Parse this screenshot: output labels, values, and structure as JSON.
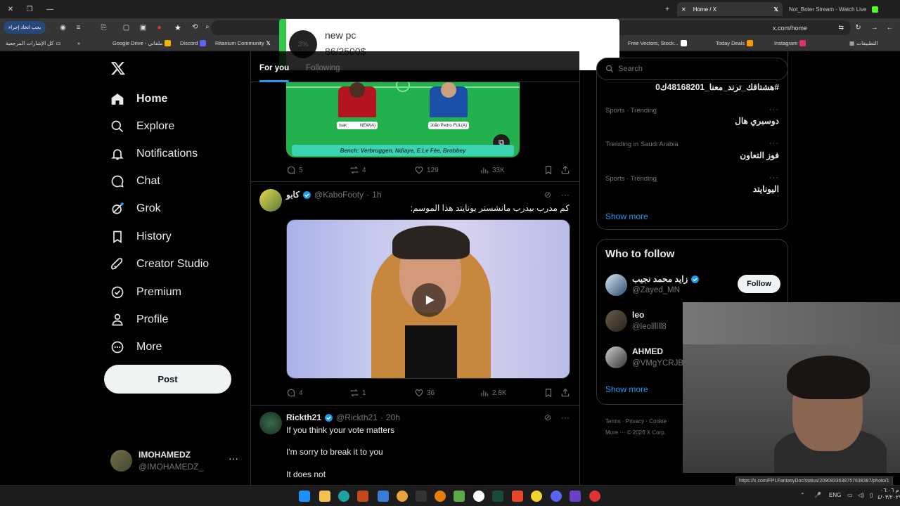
{
  "browser": {
    "tabs": [
      {
        "label": "Home / X",
        "active": true
      },
      {
        "label": "Not_Boter Stream - Watch Live",
        "active": false
      }
    ],
    "url": "x.com/home",
    "extension_pill": "يجب اتخاذ إجراء",
    "bookmarks": [
      {
        "label": "كل الإشارات المرجعية"
      },
      {
        "label": "Google Drive - ملفاتي"
      },
      {
        "label": "Discord"
      },
      {
        "label": "Ritanium Community"
      },
      {
        "label": "Free Vectors, Stock..."
      },
      {
        "label": "Today Deals"
      },
      {
        "label": "Instagram"
      },
      {
        "label": "التطبيقات"
      }
    ],
    "status_url": "https://x.com/FPLFantasyDoc/status/2090833638757638387/photo/1"
  },
  "popup": {
    "title": "new pc",
    "amount": "86/2500$",
    "percent_label": "3%"
  },
  "nav": {
    "items": [
      {
        "label": "Home",
        "icon": "home-icon",
        "active": true
      },
      {
        "label": "Explore",
        "icon": "search-icon"
      },
      {
        "label": "Notifications",
        "icon": "bell-icon"
      },
      {
        "label": "Chat",
        "icon": "chat-icon"
      },
      {
        "label": "Grok",
        "icon": "grok-icon"
      },
      {
        "label": "History",
        "icon": "bookmark-icon"
      },
      {
        "label": "Creator Studio",
        "icon": "rocket-icon"
      },
      {
        "label": "Premium",
        "icon": "verified-icon"
      },
      {
        "label": "Profile",
        "icon": "person-icon"
      },
      {
        "label": "More",
        "icon": "more-circle-icon"
      }
    ],
    "post_label": "Post",
    "account": {
      "name": "IMOHAMEDZ",
      "handle": "@IMOHAMEDZ_"
    }
  },
  "feed": {
    "tabs": [
      {
        "label": "For you",
        "active": true
      },
      {
        "label": "Following"
      }
    ],
    "tweet1": {
      "players": [
        {
          "label": "Isak",
          "tag": "NEW(A)"
        },
        {
          "label": "João Pedro",
          "tag": "FUL(A)"
        }
      ],
      "bench_text": "Bench: Verbruggen, Ndiaye, E.Le Fée, Brobbey",
      "replies": "5",
      "reposts": "4",
      "likes": "129",
      "views": "33K"
    },
    "tweet2": {
      "name": "كابو",
      "handle": "@KaboFooty",
      "time": "1h",
      "text": "كم مدرب بيدرب مانشستر يونايتد هذا الموسم:",
      "replies": "4",
      "reposts": "1",
      "likes": "36",
      "views": "2.8K"
    },
    "tweet3": {
      "name": "Rickth21",
      "handle": "@Rickth21",
      "time": "20h",
      "lines": [
        "If you think your vote matters",
        "I'm sorry to break it to you",
        "It does not"
      ]
    }
  },
  "sidebar": {
    "search_placeholder": "Search",
    "trends": [
      {
        "meta": "",
        "name": "#هشتاقك_ترند_معنا_48168201ك0"
      },
      {
        "meta": "Sports · Trending",
        "name": "دوسبري هال"
      },
      {
        "meta": "Trending in Saudi Arabia",
        "name": "فوز التعاون"
      },
      {
        "meta": "Sports · Trending",
        "name": "اليونايتد"
      }
    ],
    "show_more": "Show more",
    "who_to_follow": {
      "title": "Who to follow",
      "users": [
        {
          "name": "زايد محمد نجيب",
          "handle": "@Zayed_MN",
          "verified": true,
          "follow_label": "Follow"
        },
        {
          "name": "leo",
          "handle": "@leollllll8"
        },
        {
          "name": "AHMED",
          "handle": "@VMgYCRJBs"
        }
      ],
      "show_more": "Show more"
    },
    "footer": {
      "line1": "Terms  ·  Privacy  ·  Cookie",
      "line2": "More ···   © 2026 X Corp."
    }
  },
  "taskbar": {
    "lang": "ENG",
    "time": "م ٠٦:٠٦",
    "date": "٤/٠٣/٢٠٢٩"
  },
  "colors": {
    "accent": "#1d9bf0",
    "popup_bar": "#31c84a",
    "pitch": "#22b14c"
  }
}
